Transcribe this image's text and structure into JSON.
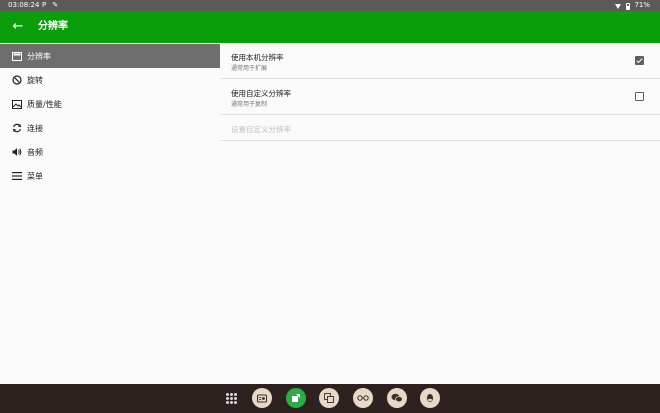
{
  "status_bar": {
    "time": "03:08:24",
    "left_icons": [
      "P",
      "✎"
    ],
    "battery": "71%"
  },
  "app_bar": {
    "title": "分辨率",
    "back_icon": "arrow-left-icon"
  },
  "sidebar": {
    "items": [
      {
        "label": "分辨率",
        "icon": "monitor-icon",
        "active": true
      },
      {
        "label": "旋转",
        "icon": "rotate-off-icon",
        "active": false
      },
      {
        "label": "质量/性能",
        "icon": "image-icon",
        "active": false
      },
      {
        "label": "连接",
        "icon": "sync-icon",
        "active": false
      },
      {
        "label": "音频",
        "icon": "volume-icon",
        "active": false
      },
      {
        "label": "菜单",
        "icon": "menu-icon",
        "active": false
      }
    ]
  },
  "prefs": [
    {
      "title": "使用本机分辨率",
      "summary": "通常用于扩展",
      "checked": true
    },
    {
      "title": "使用自定义分辨率",
      "summary": "通常用于复制",
      "checked": false
    },
    {
      "title": "设置自定义分辨率",
      "summary": "",
      "disabled": true
    }
  ],
  "nav_dock": {
    "apps": [
      "app-drawer-icon",
      "radio-icon",
      "green-app-icon",
      "translate-icon",
      "glasses-icon",
      "wechat-icon",
      "qq-icon"
    ]
  },
  "colors": {
    "accent": "#0a9e0a",
    "active_item": "#6e6e6e",
    "status_bar": "#5a5a5a",
    "nav_bar": "#2d2220"
  }
}
